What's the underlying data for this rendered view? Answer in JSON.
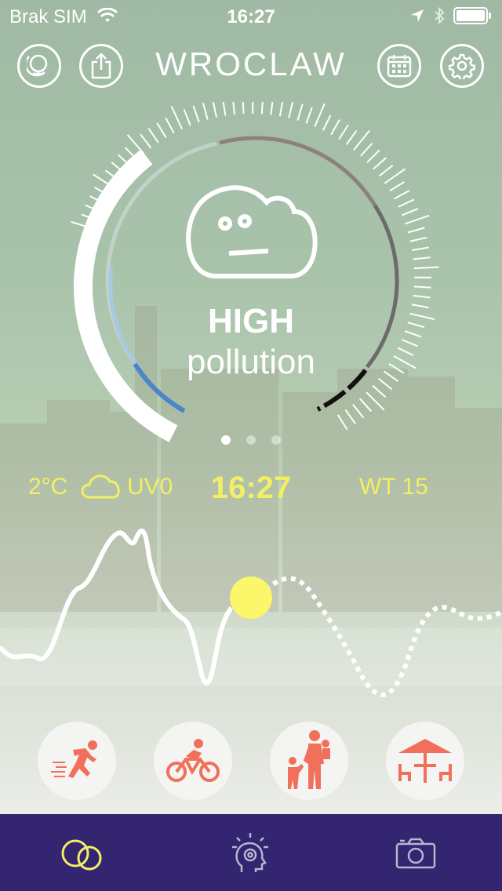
{
  "status_bar": {
    "carrier": "Brak SIM",
    "time": "16:27"
  },
  "header": {
    "city": "WROCLAW"
  },
  "pollution": {
    "level": "HIGH",
    "label": "pollution"
  },
  "weather": {
    "temperature": "2°C",
    "uv": "UV0",
    "time": "16:27",
    "day": "WT 15"
  },
  "pager": {
    "pages": 3,
    "active": 0
  },
  "colors": {
    "accent_yellow": "#f3ef64",
    "tabbar_bg": "#33256f",
    "activity_icon": "#f0705a"
  },
  "activities": [
    {
      "name": "running",
      "icon": "runner-icon"
    },
    {
      "name": "cycling",
      "icon": "bicycle-icon"
    },
    {
      "name": "walking-with-kids",
      "icon": "family-icon"
    },
    {
      "name": "outdoor-dining",
      "icon": "table-umbrella-icon"
    }
  ],
  "tabs": [
    {
      "name": "weather",
      "icon": "clouds-icon",
      "active": true
    },
    {
      "name": "tips",
      "icon": "head-lightbulb-icon",
      "active": false
    },
    {
      "name": "camera",
      "icon": "camera-icon",
      "active": false
    }
  ]
}
